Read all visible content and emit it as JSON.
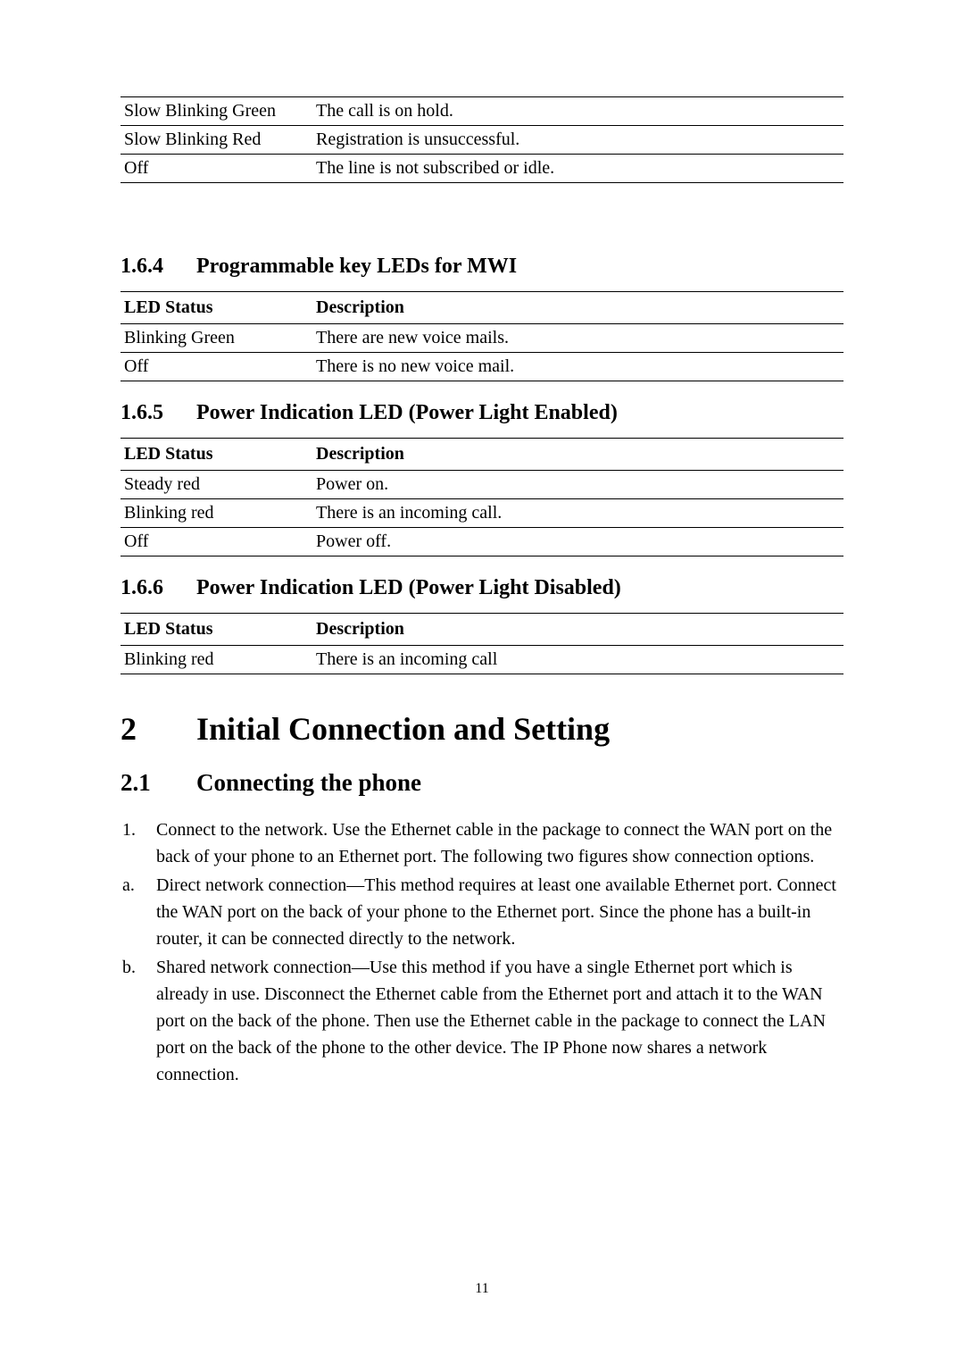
{
  "table1": {
    "rows": [
      {
        "status": "Slow Blinking Green",
        "desc": "The call is on hold."
      },
      {
        "status": "Slow Blinking Red",
        "desc": "Registration is unsuccessful."
      },
      {
        "status": "Off",
        "desc": "The line is not subscribed or idle."
      }
    ]
  },
  "section164": {
    "num": "1.6.4",
    "title": "Programmable key LEDs for MWI"
  },
  "table2": {
    "header": {
      "col1": "LED Status",
      "col2": "Description"
    },
    "rows": [
      {
        "status": "Blinking Green",
        "desc": "There are new voice mails."
      },
      {
        "status": "Off",
        "desc": "There is no new voice mail."
      }
    ]
  },
  "section165": {
    "num": "1.6.5",
    "title": "Power Indication LED (Power Light Enabled)"
  },
  "table3": {
    "header": {
      "col1": "LED Status",
      "col2": "Description"
    },
    "rows": [
      {
        "status": "Steady red",
        "desc": "Power on."
      },
      {
        "status": "Blinking red",
        "desc": "There is an incoming call."
      },
      {
        "status": "Off",
        "desc": "Power off."
      }
    ]
  },
  "section166": {
    "num": "1.6.6",
    "title": "Power Indication LED (Power Light Disabled)"
  },
  "table4": {
    "header": {
      "col1": "LED Status",
      "col2": "Description"
    },
    "rows": [
      {
        "status": "Blinking red",
        "desc": "There is an incoming call"
      }
    ]
  },
  "chapter2": {
    "num": "2",
    "title": "Initial Connection and Setting"
  },
  "section21": {
    "num": "2.1",
    "title": "Connecting the phone"
  },
  "list": {
    "items": [
      {
        "marker": "1.",
        "text": "Connect to the network. Use the Ethernet cable in the package to connect the WAN port on the back of your phone to an Ethernet port. The following two figures show connection options."
      },
      {
        "marker": "a.",
        "text": "Direct network connection—This method requires at least one available Ethernet port. Connect the WAN port on the back of your phone to the Ethernet port. Since the phone has a built-in router, it can be connected directly to the network."
      },
      {
        "marker": "b.",
        "text": "Shared network connection—Use this method if you have a single Ethernet port which is already in use.   Disconnect the Ethernet cable from the Ethernet port and attach it to the WAN port on the back of the phone. Then use the Ethernet cable in the package to connect the LAN port on the back of the phone to the other device. The IP Phone now shares a network connection."
      }
    ]
  },
  "pageNumber": "11"
}
